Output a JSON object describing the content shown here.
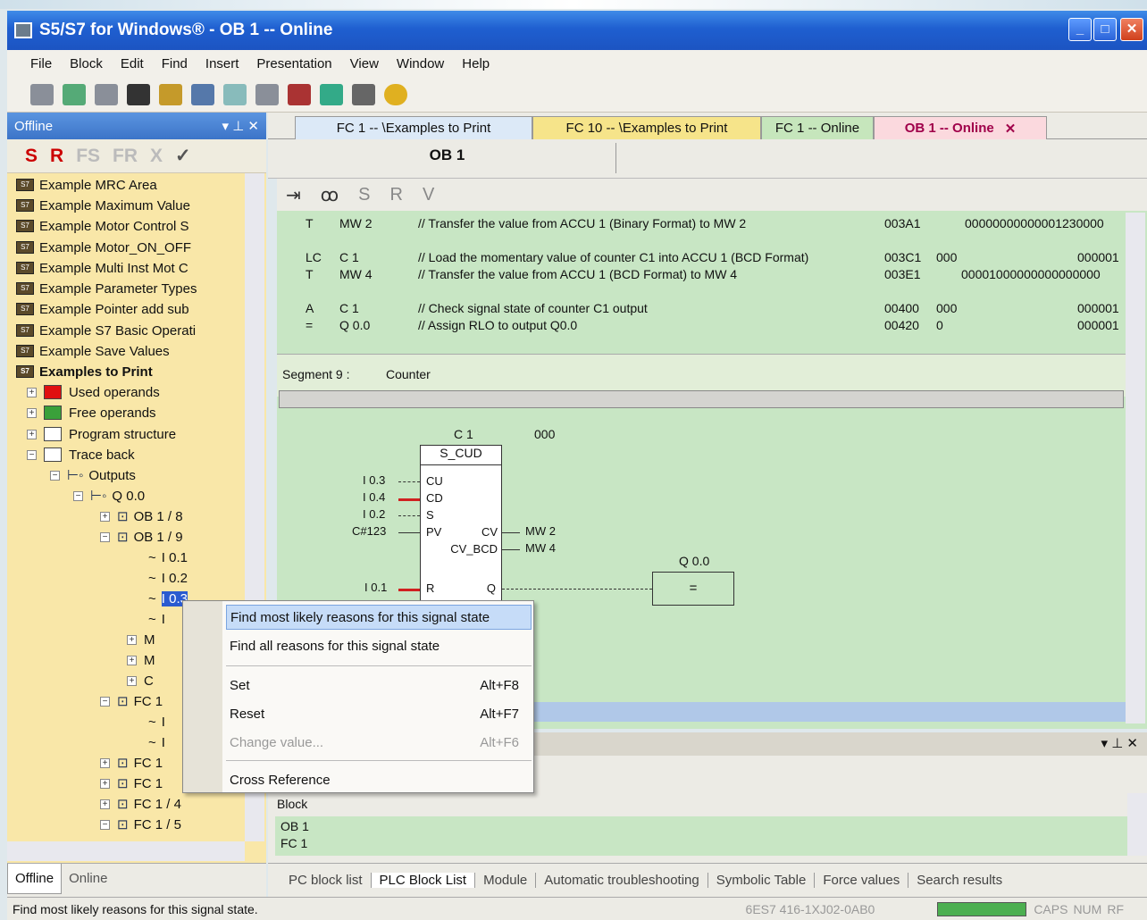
{
  "window": {
    "title": "S5/S7 for Windows® - OB 1 -- Online"
  },
  "menu": [
    "File",
    "Block",
    "Edit",
    "Find",
    "Insert",
    "Presentation",
    "View",
    "Window",
    "Help"
  ],
  "left_panel": {
    "title": "Offline",
    "tools": [
      "S",
      "R",
      "FS",
      "FR",
      "X",
      "✓"
    ],
    "items": [
      "Example MRC Area",
      "Example Maximum Value",
      "Example Motor Control S",
      "Example Motor_ON_OFF",
      "Example Multi Inst Mot C",
      "Example Parameter Types",
      "Example Pointer add sub",
      "Example S7 Basic Operati",
      "Example Save Values",
      "Examples to Print"
    ],
    "tree": [
      "Used operands",
      "Free operands",
      "Program structure",
      "Trace back",
      "Outputs",
      "Q 0.0",
      "OB 1 / 8",
      "OB 1 / 9",
      "I 0.1",
      "I 0.2",
      "I 0.3",
      "I",
      "M",
      "M",
      "C",
      "FC 1",
      "I",
      "I",
      "FC 1",
      "FC 1",
      "FC 1 / 4",
      "FC 1 / 5"
    ],
    "tabs": [
      "Offline",
      "Online"
    ]
  },
  "tabs": [
    {
      "label": "FC 1 -- \\Examples to Print"
    },
    {
      "label": "FC 10 -- \\Examples to Print"
    },
    {
      "label": "FC 1 -- Online"
    },
    {
      "label": "OB 1 -- Online"
    }
  ],
  "block_title": "OB 1",
  "editor_tools": [
    "S",
    "R",
    "V"
  ],
  "code": [
    {
      "op": "T",
      "arg": "MW 2",
      "cmt": "// Transfer the value from ACCU 1 (Binary Format) to MW 2",
      "addr": "003A1",
      "val": "",
      "st": "00000000000001230000"
    },
    {
      "op": "LC",
      "arg": "C 1",
      "cmt": "// Load the momentary value of counter C1 into ACCU 1 (BCD Format)",
      "addr": "003C1",
      "val": "000",
      "st": "000001"
    },
    {
      "op": "T",
      "arg": "MW 4",
      "cmt": "// Transfer the value from ACCU 1 (BCD Format) to MW 4",
      "addr": "003E1",
      "val": "",
      "st": "00001000000000000000"
    },
    {
      "op": "A",
      "arg": "C 1",
      "cmt": "// Check signal state of counter C1 output",
      "addr": "00400",
      "val": "000",
      "st": "000001"
    },
    {
      "op": "=",
      "arg": "Q 0.0",
      "cmt": "// Assign RLO to output Q0.0",
      "addr": "00420",
      "val": "0",
      "st": "000001"
    }
  ],
  "segment": {
    "label": "Segment 9 :",
    "name": "Counter"
  },
  "fbd": {
    "counter": "C 1",
    "value": "000",
    "box": "S_CUD",
    "inputs": [
      {
        "name": "CU",
        "sig": "I 0.3"
      },
      {
        "name": "CD",
        "sig": "I 0.4"
      },
      {
        "name": "S",
        "sig": "I 0.2"
      },
      {
        "name": "PV",
        "sig": "C#123"
      },
      {
        "name": "R",
        "sig": "I 0.1"
      }
    ],
    "outputs": [
      {
        "name": "CV",
        "sig": "MW 2"
      },
      {
        "name": "CV_BCD",
        "sig": "MW 4"
      },
      {
        "name": "Q",
        "sig": ""
      }
    ],
    "coil": "Q 0.0",
    "coil_sym": "="
  },
  "context_menu": [
    {
      "label": "Find most likely reasons for this signal state",
      "acc": ""
    },
    {
      "label": "Find all reasons for this signal state",
      "acc": ""
    },
    {
      "label": "Set",
      "acc": "Alt+F8"
    },
    {
      "label": "Reset",
      "acc": "Alt+F7"
    },
    {
      "label": "Change value...",
      "acc": "Alt+F6"
    },
    {
      "label": "Cross Reference",
      "acc": ""
    }
  ],
  "bottom": {
    "col": "Block",
    "rows": [
      "OB 1",
      "FC 1"
    ]
  },
  "bottom_tabs": [
    "PC block list",
    "PLC Block List",
    "Module",
    "Automatic troubleshooting",
    "Symbolic Table",
    "Force values",
    "Search results"
  ],
  "status": {
    "text": "Find most likely reasons for this signal state.",
    "device": "6ES7 416-1XJ02-0AB0",
    "caps": "CAPS",
    "num": "NUM",
    "rf": "RF"
  }
}
